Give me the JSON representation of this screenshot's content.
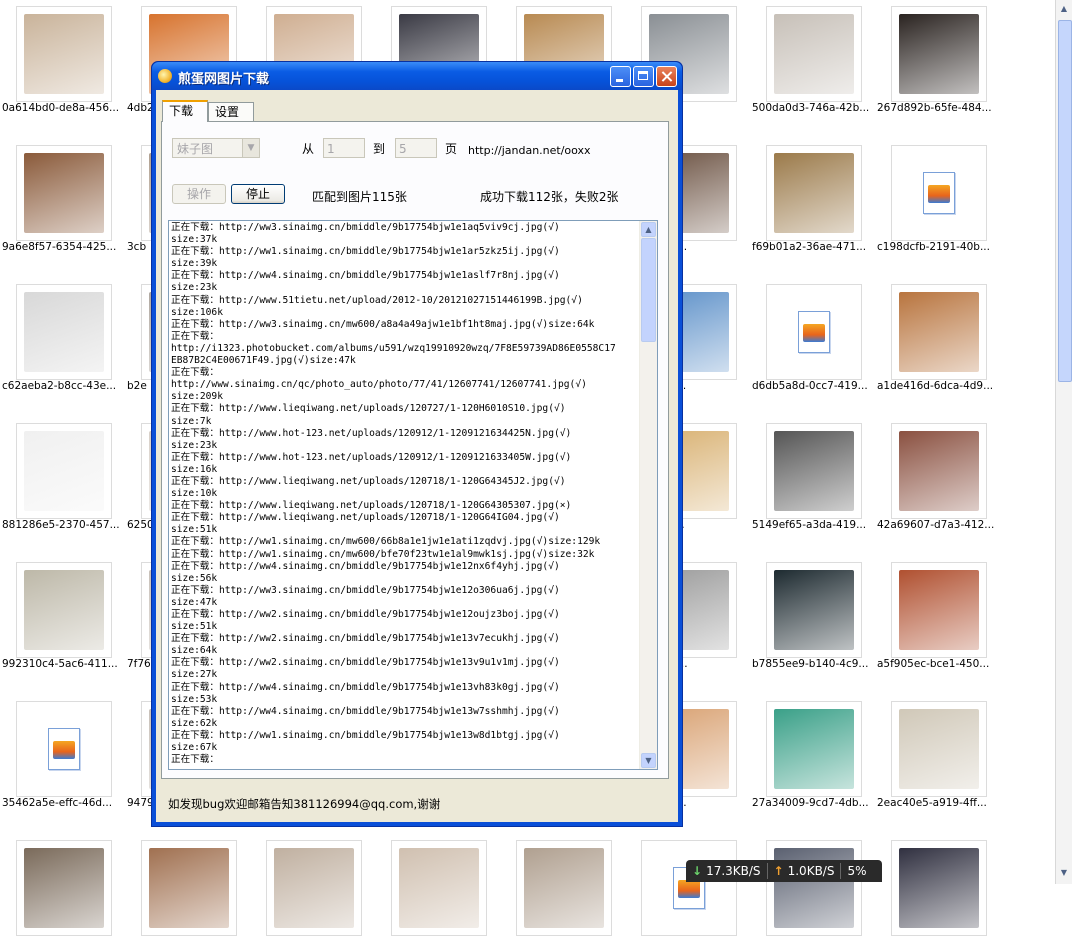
{
  "explorer": {
    "thumbnails": [
      {
        "name": "0a614bd0-de8a-456...",
        "kind": "photo",
        "color": "#c9b39a"
      },
      {
        "name": "4db2",
        "kind": "photo",
        "color": "#d7732e"
      },
      {
        "name": "",
        "kind": "photo",
        "color": "#cfae91"
      },
      {
        "name": "",
        "kind": "photo",
        "color": "#3a3a44"
      },
      {
        "name": "",
        "kind": "photo",
        "color": "#b88a52"
      },
      {
        "name": "f19f-45f...",
        "kind": "photo",
        "color": "#8a8f94"
      },
      {
        "name": "500da0d3-746a-42b...",
        "kind": "photo",
        "color": "#c7c0b8"
      },
      {
        "name": "267d892b-65fe-484...",
        "kind": "photo",
        "color": "#2a2320"
      },
      {
        "name": "9a6e8f57-6354-425...",
        "kind": "photo",
        "color": "#8a5a3a"
      },
      {
        "name": "3cb",
        "kind": "photo",
        "color": "#b0a090"
      },
      {
        "name": "",
        "kind": "photo",
        "color": "#d0c0b0"
      },
      {
        "name": "",
        "kind": "photo",
        "color": "#c0b0a0"
      },
      {
        "name": "",
        "kind": "photo",
        "color": "#a09080"
      },
      {
        "name": "a798-47a...",
        "kind": "photo",
        "color": "#6a5040"
      },
      {
        "name": "f69b01a2-36ae-471...",
        "kind": "photo",
        "color": "#9b7a4a"
      },
      {
        "name": "c198dcfb-2191-40b...",
        "kind": "file",
        "color": ""
      },
      {
        "name": "c62aeba2-b8cc-43e...",
        "kind": "photo",
        "color": "#d8d8d8"
      },
      {
        "name": "b2e",
        "kind": "photo",
        "color": "#b0a8a0"
      },
      {
        "name": "",
        "kind": "photo",
        "color": "#c8c0b8"
      },
      {
        "name": "",
        "kind": "photo",
        "color": "#b8b0a8"
      },
      {
        "name": "",
        "kind": "photo",
        "color": "#a8a098"
      },
      {
        "name": "0a37-4ac...",
        "kind": "photo",
        "color": "#5b8fc8"
      },
      {
        "name": "d6db5a8d-0cc7-419...",
        "kind": "file",
        "color": ""
      },
      {
        "name": "a1de416d-6dca-4d9...",
        "kind": "photo",
        "color": "#b8743e"
      },
      {
        "name": "881286e5-2370-457...",
        "kind": "photo",
        "color": "#f0f0f0"
      },
      {
        "name": "6250",
        "kind": "photo",
        "color": "#d8d0c8"
      },
      {
        "name": "",
        "kind": "photo",
        "color": "#c8c0b8"
      },
      {
        "name": "",
        "kind": "photo",
        "color": "#b8b0a8"
      },
      {
        "name": "",
        "kind": "photo",
        "color": "#a8a098"
      },
      {
        "name": "91f7-467...",
        "kind": "photo",
        "color": "#d8b070"
      },
      {
        "name": "5149ef65-a3da-419...",
        "kind": "photo",
        "color": "#555555"
      },
      {
        "name": "42a69607-d7a3-412...",
        "kind": "photo",
        "color": "#8a5040"
      },
      {
        "name": "992310c4-5ac6-411...",
        "kind": "photo",
        "color": "#bdb8a8"
      },
      {
        "name": "7f76",
        "kind": "photo",
        "color": "#c8c0b8"
      },
      {
        "name": "",
        "kind": "photo",
        "color": "#b8b0a8"
      },
      {
        "name": "",
        "kind": "photo",
        "color": "#a8a098"
      },
      {
        "name": "",
        "kind": "photo",
        "color": "#989088"
      },
      {
        "name": "8316-417...",
        "kind": "photo",
        "color": "#9a9a9a"
      },
      {
        "name": "b7855ee9-b140-4c9...",
        "kind": "photo",
        "color": "#1d2a30"
      },
      {
        "name": "a5f905ec-bce1-450...",
        "kind": "photo",
        "color": "#b05030"
      },
      {
        "name": "35462a5e-effc-46d...",
        "kind": "file",
        "color": ""
      },
      {
        "name": "9479",
        "kind": "photo",
        "color": "#c8c0b8"
      },
      {
        "name": "",
        "kind": "photo",
        "color": "#b8b0a8"
      },
      {
        "name": "",
        "kind": "photo",
        "color": "#a8a098"
      },
      {
        "name": "",
        "kind": "photo",
        "color": "#989088"
      },
      {
        "name": "1d1c-455...",
        "kind": "photo",
        "color": "#d8a070"
      },
      {
        "name": "27a34009-9cd7-4db...",
        "kind": "photo",
        "color": "#3aa088"
      },
      {
        "name": "2eac40e5-a919-4ff...",
        "kind": "photo",
        "color": "#d0c8b8"
      },
      {
        "name": "",
        "kind": "photo",
        "color": "#7a6a5a"
      },
      {
        "name": "",
        "kind": "photo",
        "color": "#a07050"
      },
      {
        "name": "",
        "kind": "photo",
        "color": "#c0b0a0"
      },
      {
        "name": "",
        "kind": "photo",
        "color": "#d0c0b0"
      },
      {
        "name": "",
        "kind": "photo",
        "color": "#b0a090"
      },
      {
        "name": "",
        "kind": "file",
        "color": ""
      },
      {
        "name": "",
        "kind": "photo",
        "color": "#5a6070"
      },
      {
        "name": "",
        "kind": "photo",
        "color": "#303040"
      }
    ]
  },
  "speedbar": {
    "download": "17.3KB/S",
    "upload": "1.0KB/S",
    "percent": "5%"
  },
  "window": {
    "title": "煎蛋网图片下载",
    "tabs": [
      "下载",
      "设置"
    ],
    "category_value": "妹子图",
    "from_label": "从",
    "from_value": "1",
    "to_label": "到",
    "to_value": "5",
    "page_label": "页",
    "url": "http://jandan.net/ooxx",
    "action_button": "操作",
    "stop_button": "停止",
    "matched_text": "匹配到图片115张",
    "result_text": "成功下载112张，失败2张",
    "log": "正在下载：http://ww3.sinaimg.cn/bmiddle/9b17754bjw1e1aq5viv9cj.jpg(√)\nsize:37k\n正在下载：http://ww1.sinaimg.cn/bmiddle/9b17754bjw1e1ar5zkz5ij.jpg(√)\nsize:39k\n正在下载：http://ww4.sinaimg.cn/bmiddle/9b17754bjw1e1aslf7r8nj.jpg(√)\nsize:23k\n正在下载：http://www.51tietu.net/upload/2012-10/20121027151446199B.jpg(√)\nsize:106k\n正在下载：http://ww3.sinaimg.cn/mw600/a8a4a49ajw1e1bf1ht8maj.jpg(√)size:64k\n正在下载：\nhttp://i1323.photobucket.com/albums/u591/wzq19910920wzq/7F8E59739AD86E0558C17\nEB87B2C4E00671F49.jpg(√)size:47k\n正在下载：\nhttp://www.sinaimg.cn/qc/photo_auto/photo/77/41/12607741/12607741.jpg(√)\nsize:209k\n正在下载：http://www.lieqiwang.net/uploads/120727/1-120H6010S10.jpg(√)\nsize:7k\n正在下载：http://www.hot-123.net/uploads/120912/1-1209121634425N.jpg(√)\nsize:23k\n正在下载：http://www.hot-123.net/uploads/120912/1-1209121633405W.jpg(√)\nsize:16k\n正在下载：http://www.lieqiwang.net/uploads/120718/1-120G64345J2.jpg(√)\nsize:10k\n正在下载：http://www.lieqiwang.net/uploads/120718/1-120G64305307.jpg(×)\n正在下载：http://www.lieqiwang.net/uploads/120718/1-120G64IG04.jpg(√)\nsize:51k\n正在下载：http://ww1.sinaimg.cn/mw600/66b8a1e1jw1e1ati1zqdvj.jpg(√)size:129k\n正在下载：http://ww1.sinaimg.cn/mw600/bfe70f23tw1e1al9mwk1sj.jpg(√)size:32k\n正在下载：http://ww4.sinaimg.cn/bmiddle/9b17754bjw1e12nx6f4yhj.jpg(√)\nsize:56k\n正在下载：http://ww3.sinaimg.cn/bmiddle/9b17754bjw1e12o306ua6j.jpg(√)\nsize:47k\n正在下载：http://ww2.sinaimg.cn/bmiddle/9b17754bjw1e12oujz3boj.jpg(√)\nsize:51k\n正在下载：http://ww2.sinaimg.cn/bmiddle/9b17754bjw1e13v7ecukhj.jpg(√)\nsize:64k\n正在下载：http://ww2.sinaimg.cn/bmiddle/9b17754bjw1e13v9u1v1mj.jpg(√)\nsize:27k\n正在下载：http://ww4.sinaimg.cn/bmiddle/9b17754bjw1e13vh83k0gj.jpg(√)\nsize:53k\n正在下载：http://ww4.sinaimg.cn/bmiddle/9b17754bjw1e13w7sshmhj.jpg(√)\nsize:62k\n正在下载：http://ww1.sinaimg.cn/bmiddle/9b17754bjw1e13w8d1btgj.jpg(√)\nsize:67k\n正在下载：",
    "footer": "如发现bug欢迎邮箱告知381126994@qq.com,谢谢"
  },
  "colors": {
    "titlebar": "#0a5ce4",
    "dialog_bg": "#ece9d8",
    "tab_accent": "#f0a000"
  },
  "icons": {
    "app": "egg-icon",
    "minimize": "minimize-icon",
    "maximize": "maximize-icon",
    "close": "close-icon",
    "download_arrow": "download-arrow-icon",
    "upload_arrow": "upload-arrow-icon"
  }
}
